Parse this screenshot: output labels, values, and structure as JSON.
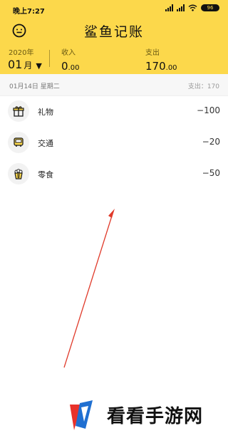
{
  "status": {
    "time": "晚上7:27",
    "battery": "96"
  },
  "header": {
    "title": "鲨鱼记账",
    "year": "2020年",
    "month": "01",
    "month_unit": "月",
    "caret": "▼",
    "income_label": "收入",
    "income_int": "0",
    "income_dec": ".00",
    "expense_label": "支出",
    "expense_int": "170",
    "expense_dec": ".00"
  },
  "day": {
    "date": "01月14日 星期二",
    "total": "支出：170"
  },
  "entries": [
    {
      "icon": "gift-icon",
      "name": "礼物",
      "amount": "−100"
    },
    {
      "icon": "bus-icon",
      "name": "交通",
      "amount": "−20"
    },
    {
      "icon": "snack-icon",
      "name": "零食",
      "amount": "−50"
    }
  ],
  "colors": {
    "accent": "#FCD84B",
    "arrow": "#E03A2A"
  },
  "watermark": {
    "text": "看看手游网"
  }
}
